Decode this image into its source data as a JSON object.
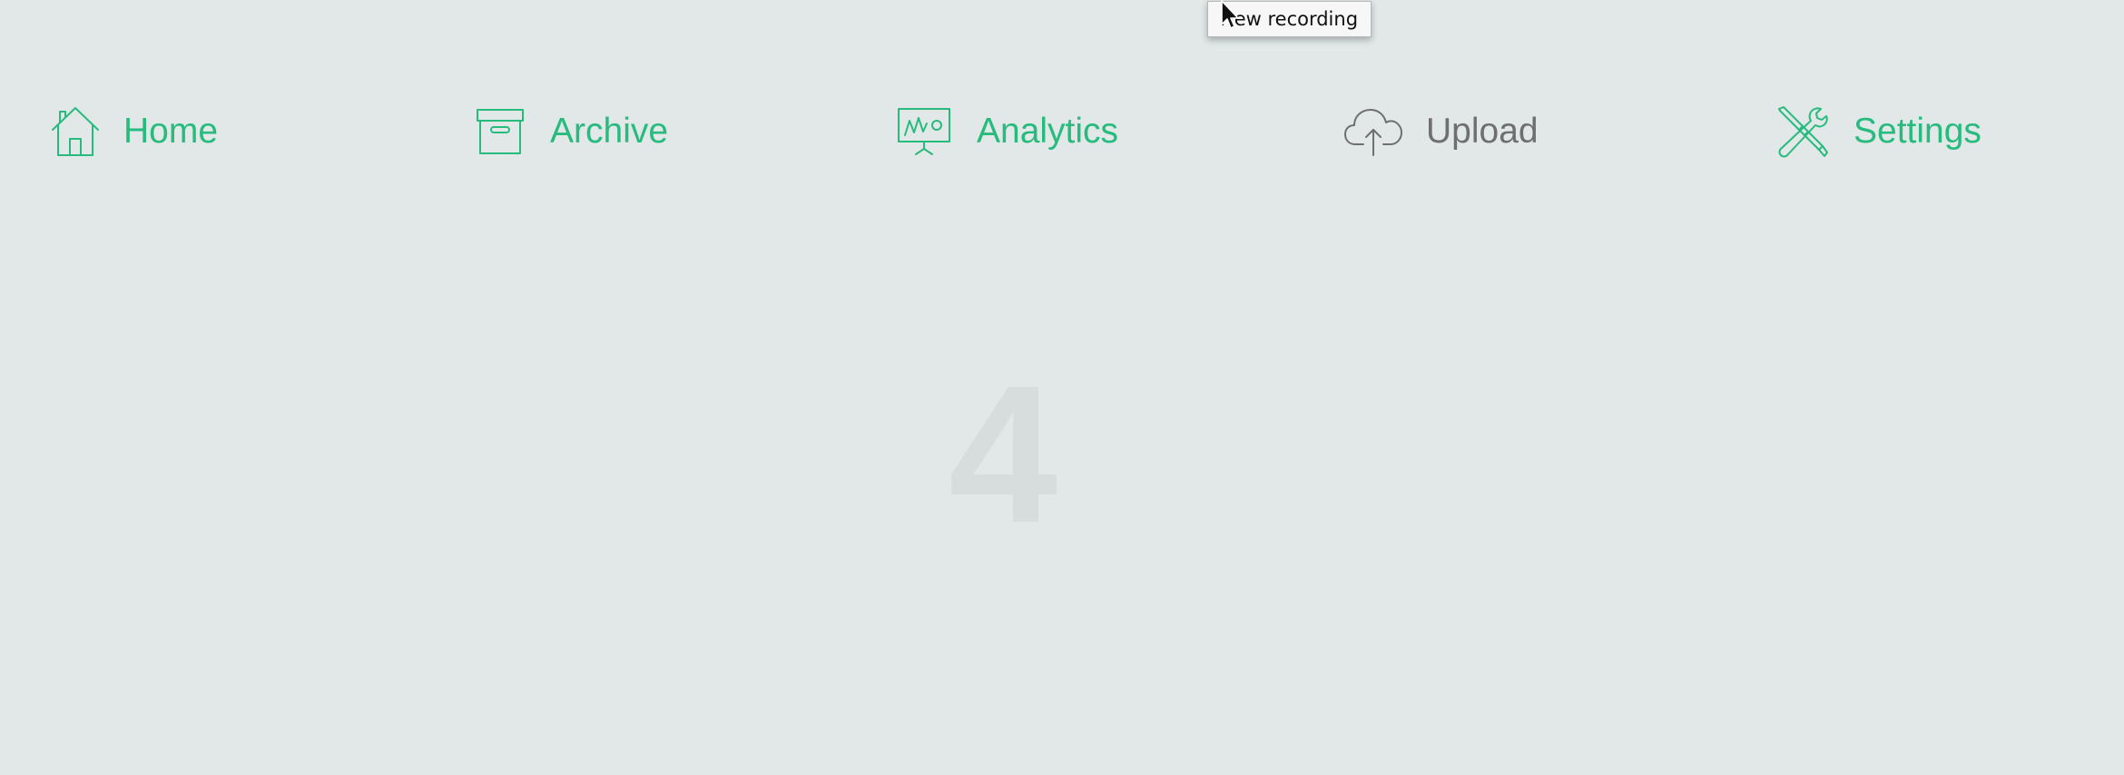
{
  "tooltip": {
    "text": "New recording"
  },
  "nav": {
    "items": [
      {
        "label": "Home",
        "icon": "home-icon",
        "state": "active"
      },
      {
        "label": "Archive",
        "icon": "archive-box-icon",
        "state": "active"
      },
      {
        "label": "Analytics",
        "icon": "presentation-chart-icon",
        "state": "active"
      },
      {
        "label": "Upload",
        "icon": "cloud-upload-icon",
        "state": "inactive"
      },
      {
        "label": "Settings",
        "icon": "wrench-screwdriver-icon",
        "state": "active"
      }
    ]
  },
  "main": {
    "page_number": "4"
  },
  "colors": {
    "background": "#e2e8e8",
    "accent": "#27bb7e",
    "inactive": "#6f6f70",
    "watermark_digit": "#d7dcdc"
  }
}
